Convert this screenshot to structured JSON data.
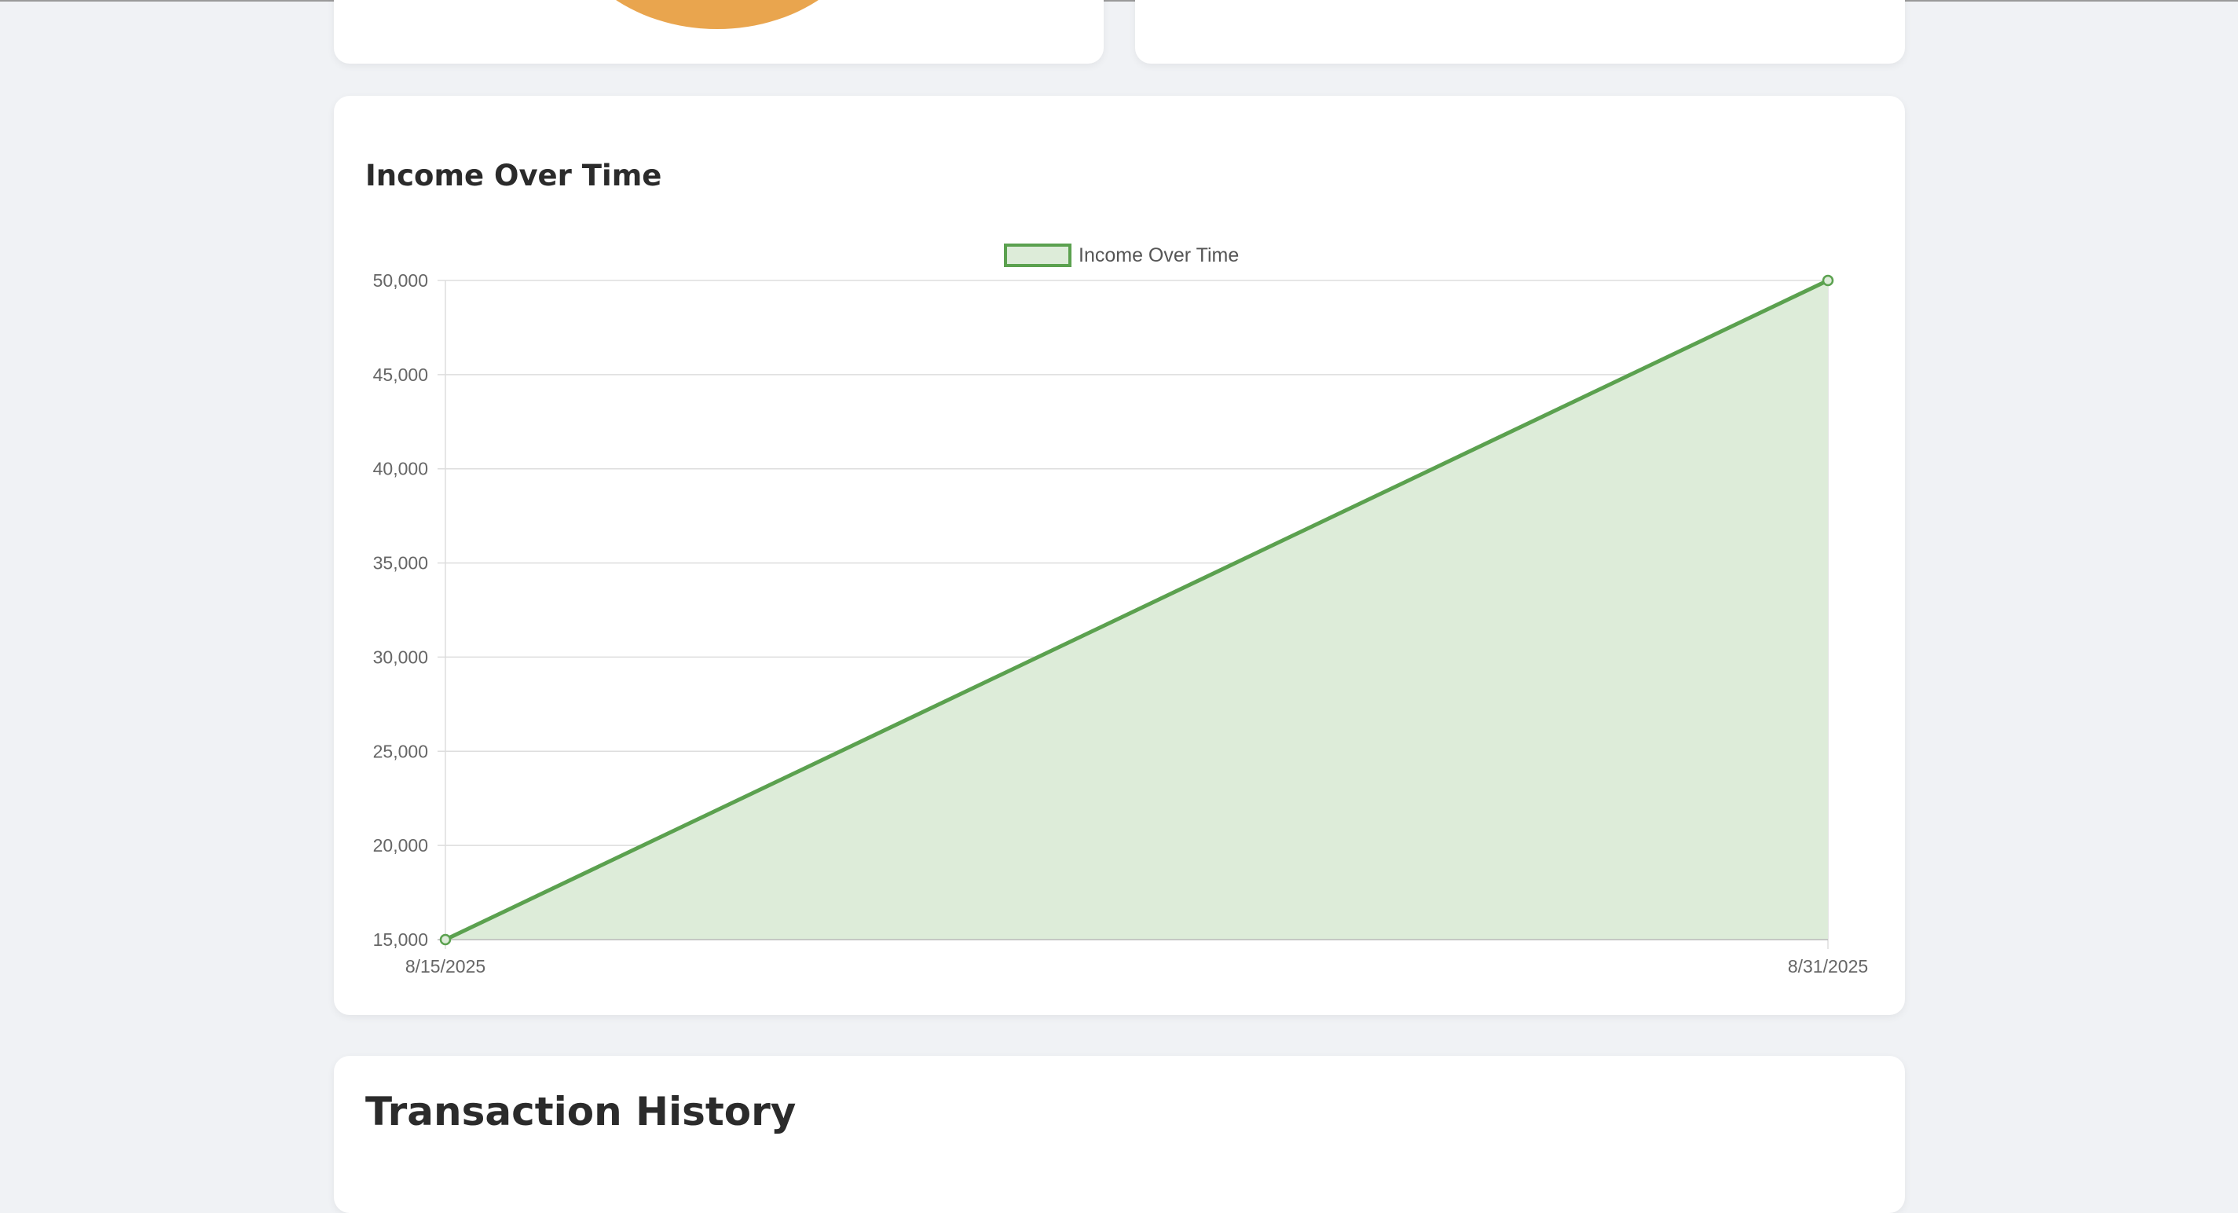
{
  "income_card": {
    "title": "Income Over Time"
  },
  "transactions_card": {
    "title": "Transaction History"
  },
  "colors": {
    "background": "#f0f2f5",
    "card": "#ffffff",
    "line": "#5ba14f",
    "fill": "#ddecd9",
    "pie_slice": "#e9a54e",
    "grid": "#dddddd",
    "text": "#666666"
  },
  "chart_data": {
    "type": "area",
    "title": "",
    "xlabel": "",
    "ylabel": "",
    "x": [
      "8/15/2025",
      "8/31/2025"
    ],
    "series": [
      {
        "name": "Income Over Time",
        "values": [
          15000,
          50000
        ]
      }
    ],
    "yticks": [
      "15,000",
      "20,000",
      "25,000",
      "30,000",
      "35,000",
      "40,000",
      "45,000",
      "50,000"
    ],
    "ylim": [
      15000,
      50000
    ],
    "ystep": 5000,
    "grid": true,
    "legend_position": "top"
  }
}
